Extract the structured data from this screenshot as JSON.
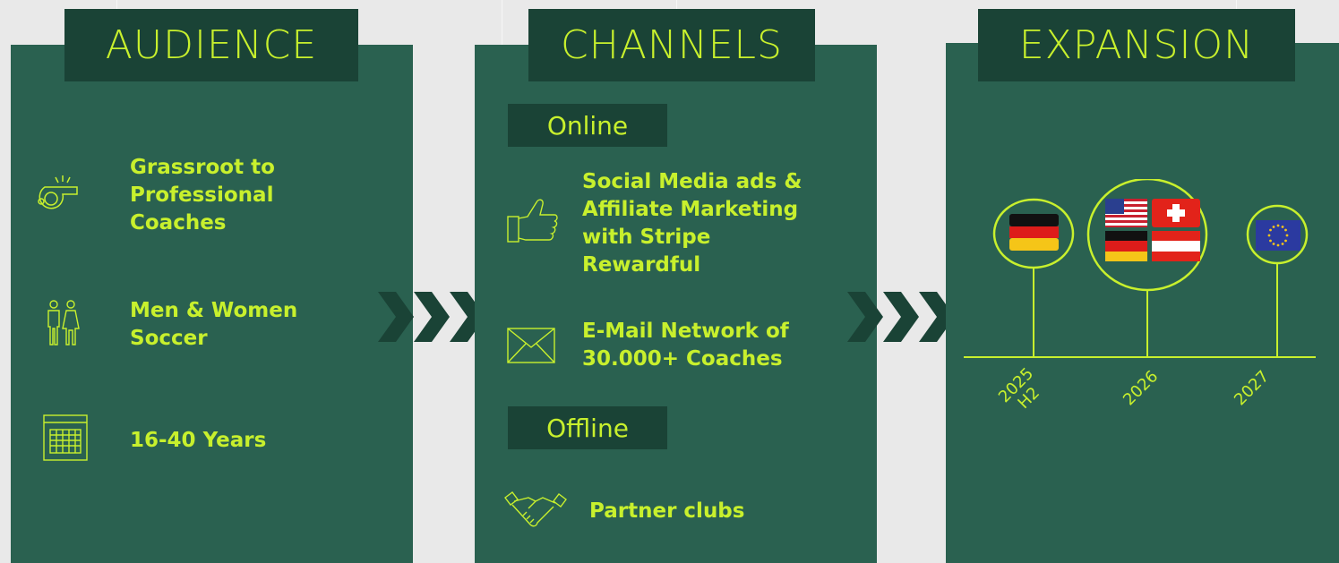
{
  "colors": {
    "accent": "#c8f02d",
    "panel": "#2a6150",
    "header": "#1a4336",
    "background": "#e9e9e9"
  },
  "audience": {
    "title": "AUDIENCE",
    "items": [
      {
        "icon": "whistle-icon",
        "text": "Grassroot to Professional Coaches"
      },
      {
        "icon": "man-woman-icon",
        "text": "Men & Women Soccer"
      },
      {
        "icon": "calendar-icon",
        "text": "16-40 Years"
      }
    ]
  },
  "channels": {
    "title": "CHANNELS",
    "online_label": "Online",
    "offline_label": "Offline",
    "items": [
      {
        "icon": "thumbs-up-icon",
        "text": "Social Media ads & Affiliate Marketing with Stripe Rewardful"
      },
      {
        "icon": "envelope-icon",
        "text": "E-Mail Network of 30.000+ Coaches"
      },
      {
        "icon": "handshake-icon",
        "text": "Partner clubs"
      }
    ]
  },
  "expansion": {
    "title": "EXPANSION",
    "timeline": [
      {
        "year": "2025",
        "sub": "H2",
        "flags": [
          "germany-flag"
        ]
      },
      {
        "year": "2026",
        "sub": "",
        "flags": [
          "usa-flag",
          "switzerland-flag",
          "germany-flag",
          "austria-flag"
        ]
      },
      {
        "year": "2027",
        "sub": "",
        "flags": [
          "eu-flag"
        ]
      }
    ]
  }
}
